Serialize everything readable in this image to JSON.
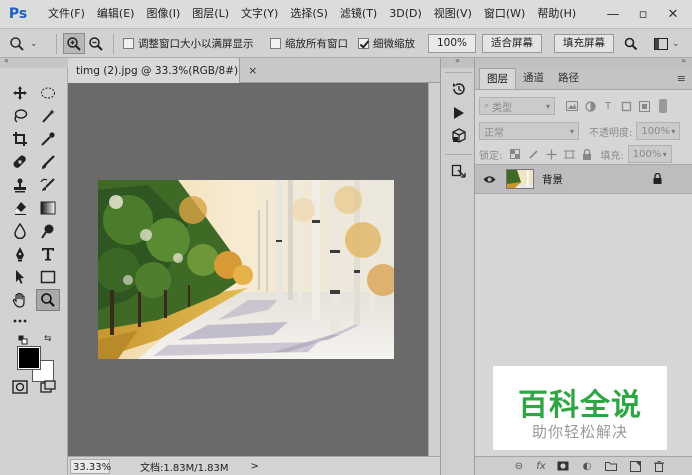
{
  "app": {
    "logo": "Ps"
  },
  "menu": [
    "文件(F)",
    "编辑(E)",
    "图像(I)",
    "图层(L)",
    "文字(Y)",
    "选择(S)",
    "滤镜(T)",
    "3D(D)",
    "视图(V)",
    "窗口(W)",
    "帮助(H)"
  ],
  "window_controls": {
    "minimize": "—",
    "maximize": "▫",
    "close": "✕"
  },
  "options_bar": {
    "checkbox_resize_windows": {
      "label": "调整窗口大小以满屏显示",
      "checked": false
    },
    "checkbox_zoom_all": {
      "label": "缩放所有窗口",
      "checked": false
    },
    "checkbox_scrubby": {
      "label": "细微缩放",
      "checked": true
    },
    "zoom_percent": "100%",
    "fit_screen": "适合屏幕",
    "fill_screen": "填充屏幕"
  },
  "document": {
    "tab_title": "timg (2).jpg @ 33.3%(RGB/8#)",
    "tab_close": "×",
    "zoom": "33.33%",
    "doc_info": "文档:1.83M/1.83M",
    "status_arrow": ">"
  },
  "layers_panel": {
    "tabs": [
      "图层",
      "通道",
      "路径"
    ],
    "active_tab": "图层",
    "filter_kind": "类型",
    "blend_mode": "正常",
    "opacity_label": "不透明度:",
    "opacity_value": "100%",
    "lock_label": "锁定:",
    "fill_label": "填充:",
    "fill_value": "100%",
    "layers": [
      {
        "name": "背景",
        "visible": true,
        "locked": true
      }
    ]
  },
  "watermark": {
    "title": "百科全说",
    "subtitle": "助你轻松解决",
    "color": "#2ea743"
  },
  "colors": {
    "foreground": "#000000",
    "background": "#ffffff",
    "canvas_bg": "#6a6a6a",
    "panel_bg": "#d6d6d6"
  }
}
